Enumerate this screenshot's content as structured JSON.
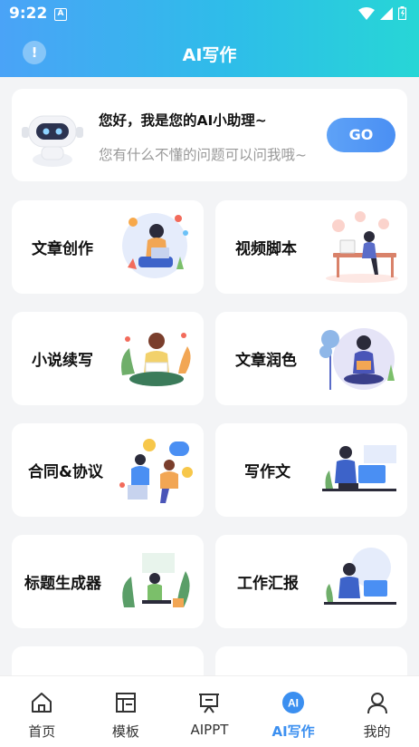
{
  "status_bar": {
    "time": "9:22",
    "notification_letter": "A"
  },
  "header": {
    "title": "AI写作",
    "info_icon": "!"
  },
  "assistant": {
    "title": "您好，我是您的AI小助理~",
    "subtitle": "您有什么不懂的问题可以问我哦~",
    "button_label": "GO"
  },
  "cards": [
    {
      "label": "文章创作",
      "icon": "woman-at-laptop-illustration"
    },
    {
      "label": "视频脚本",
      "icon": "woman-at-desk-illustration"
    },
    {
      "label": "小说续写",
      "icon": "woman-reading-illustration"
    },
    {
      "label": "文章润色",
      "icon": "woman-reading-tree-illustration"
    },
    {
      "label": "合同&协议",
      "icon": "two-people-chatting-illustration"
    },
    {
      "label": "写作文",
      "icon": "man-at-computer-illustration"
    },
    {
      "label": "标题生成器",
      "icon": "woman-plants-illustration"
    },
    {
      "label": "工作汇报",
      "icon": "man-at-laptop-illustration"
    }
  ],
  "tabs": [
    {
      "label": "首页",
      "icon": "home-icon"
    },
    {
      "label": "模板",
      "icon": "template-icon"
    },
    {
      "label": "AIPPT",
      "icon": "presentation-icon"
    },
    {
      "label": "AI写作",
      "icon": "ai-icon",
      "active": true
    },
    {
      "label": "我的",
      "icon": "user-icon"
    }
  ],
  "colors": {
    "accent": "#3b8ff0",
    "header_start": "#4aa3f7",
    "header_end": "#27d6d6"
  }
}
